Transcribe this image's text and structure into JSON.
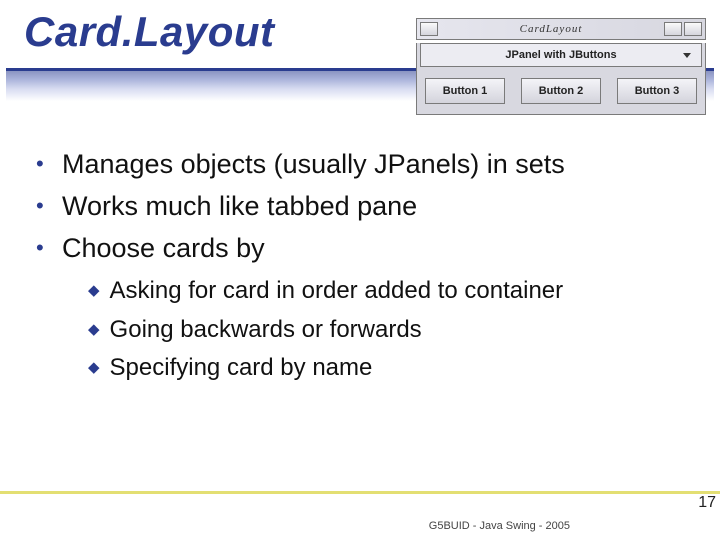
{
  "title": "Card.Layout",
  "applet": {
    "windowTitle": "CardLayout",
    "comboLabel": "JPanel with JButtons",
    "buttons": [
      "Button 1",
      "Button 2",
      "Button 3"
    ]
  },
  "bullets": [
    "Manages objects (usually JPanels) in sets",
    "Works much like tabbed pane",
    "Choose cards by"
  ],
  "subbullets": [
    "Asking for card in order added to container",
    "Going backwards or forwards",
    "Specifying card by name"
  ],
  "footer": "G5BUID - Java Swing - 2005",
  "page": "17"
}
